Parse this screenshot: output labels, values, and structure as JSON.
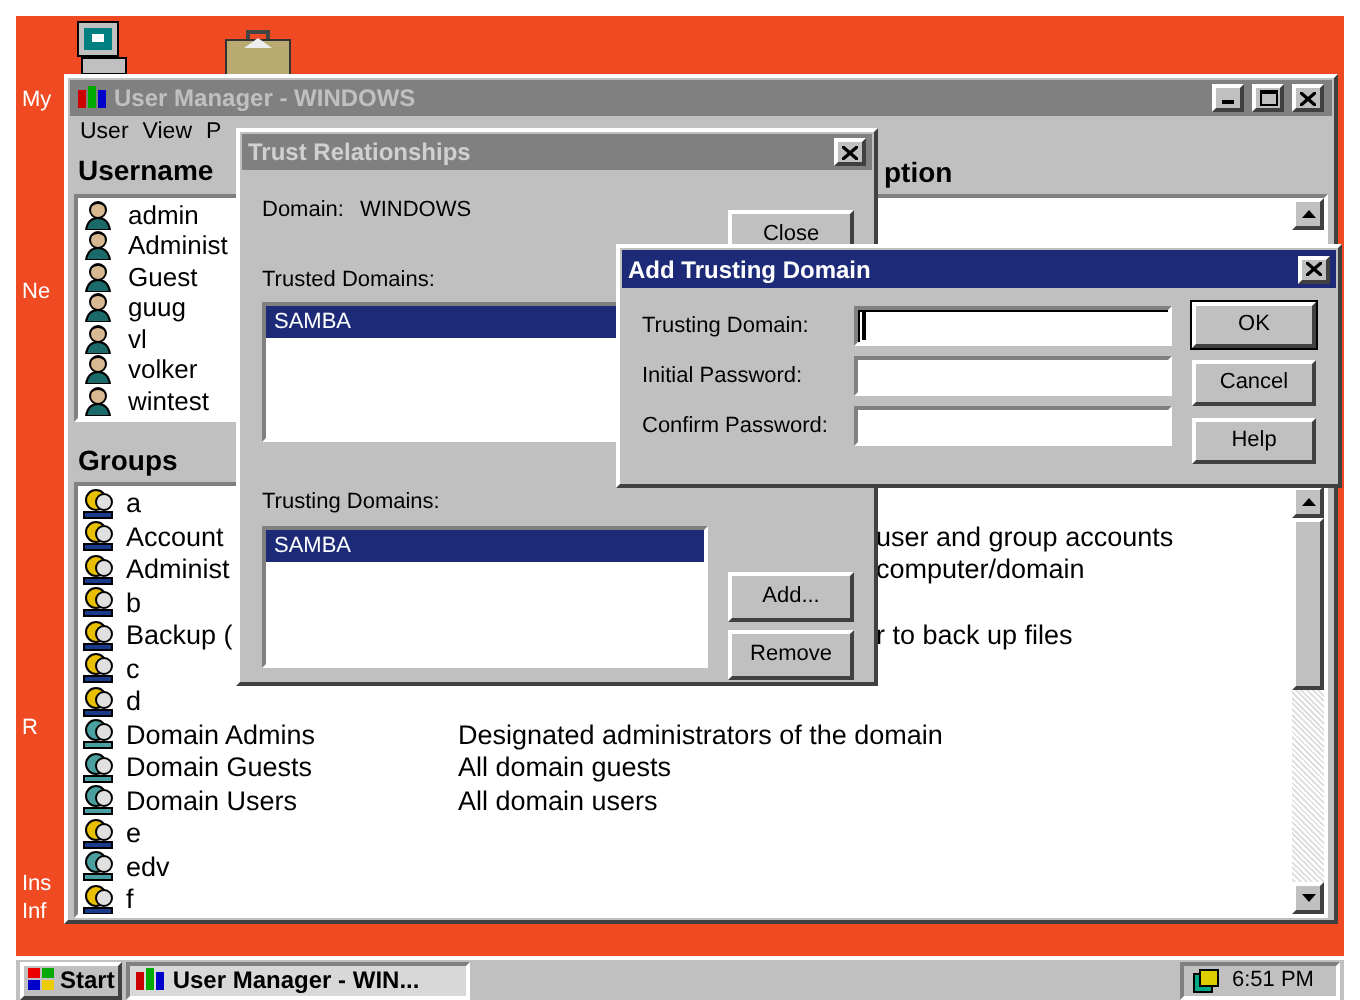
{
  "desktop": {
    "icon_labels": [
      {
        "label": "My"
      },
      {
        "label": "Ne"
      },
      {
        "label": "R"
      },
      {
        "label": "Ins"
      },
      {
        "label": "Inf"
      }
    ]
  },
  "user_manager": {
    "title": "User Manager - WINDOWS",
    "menu": [
      "User",
      "View",
      "P"
    ],
    "users": {
      "header": "Username",
      "column_2": "ption",
      "rows": [
        "admin",
        "Administ",
        "Guest",
        "guug",
        "vl",
        "volker",
        "wintest"
      ]
    },
    "groups": {
      "header": "Groups",
      "rows": [
        {
          "name": "a",
          "kind": "plain"
        },
        {
          "name": "Account",
          "description": "user and group accounts",
          "kind": "partly_hidden"
        },
        {
          "name": "Administ",
          "description": "computer/domain",
          "kind": "partly_hidden"
        },
        {
          "name": "b",
          "kind": "plain"
        },
        {
          "name": "Backup (",
          "description": "r to back up files",
          "kind": "partly_hidden"
        },
        {
          "name": "c",
          "kind": "plain"
        },
        {
          "name": "d",
          "kind": "plain"
        },
        {
          "name": "Domain Admins",
          "description": "Designated administrators of the domain",
          "kind": "global"
        },
        {
          "name": "Domain Guests",
          "description": "All domain guests",
          "kind": "global"
        },
        {
          "name": "Domain Users",
          "description": "All domain users",
          "kind": "global"
        },
        {
          "name": "e",
          "kind": "plain"
        },
        {
          "name": "edv",
          "kind": "global"
        },
        {
          "name": "f",
          "kind": "plain"
        }
      ]
    }
  },
  "trust_dialog": {
    "title": "Trust Relationships",
    "domain_label": "Domain:",
    "domain": "WINDOWS",
    "close_button": "Close",
    "trusted_label": "Trusted Domains:",
    "trusted": [
      {
        "name": "SAMBA",
        "selected": true
      }
    ],
    "trusting_label": "Trusting Domains:",
    "trusting": [
      {
        "name": "SAMBA",
        "selected": true
      }
    ],
    "add_button": "Add...",
    "remove_button": "Remove"
  },
  "add_dialog": {
    "title": "Add Trusting Domain",
    "fields": [
      {
        "label": "Trusting Domain:",
        "focused": true
      },
      {
        "label": "Initial Password:",
        "focused": false
      },
      {
        "label": "Confirm Password:",
        "focused": false
      }
    ],
    "buttons": [
      {
        "label": "OK",
        "default": true
      },
      {
        "label": "Cancel",
        "default": false
      },
      {
        "label": "Help",
        "default": false
      }
    ]
  },
  "taskbar": {
    "start": "Start",
    "task": "User Manager - WIN...",
    "clock": "6:51 PM"
  }
}
